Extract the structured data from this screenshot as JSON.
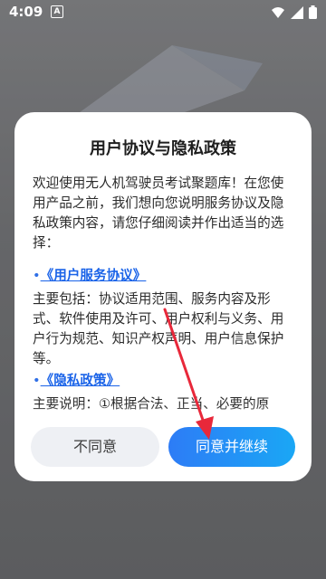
{
  "status_bar": {
    "time": "4:09",
    "notif_badge": "A"
  },
  "dialog": {
    "title": "用户协议与隐私政策",
    "intro": "欢迎使用无人机驾驶员考试聚题库！在您使用产品之前，我们想向您说明服务协议及隐私政策内容，请您仔细阅读并作出适当的选择：",
    "bullet": "•",
    "service_link": "《用户服务协议》",
    "service_desc": "主要包括：协议适用范围、服务内容及形式、软件使用及许可、用户权利与义务、用户行为规范、知识产权声明、用户信息保护等。",
    "privacy_link": "《隐私政策》",
    "privacy_desc": "主要说明：①根据合法、正当、必要的原"
  },
  "buttons": {
    "disagree": "不同意",
    "agree": "同意并继续"
  },
  "colors": {
    "link": "#1a63e8",
    "agree_start": "#2d7cf6",
    "agree_end": "#1aa7f5",
    "annotation_arrow": "#e8283a"
  }
}
